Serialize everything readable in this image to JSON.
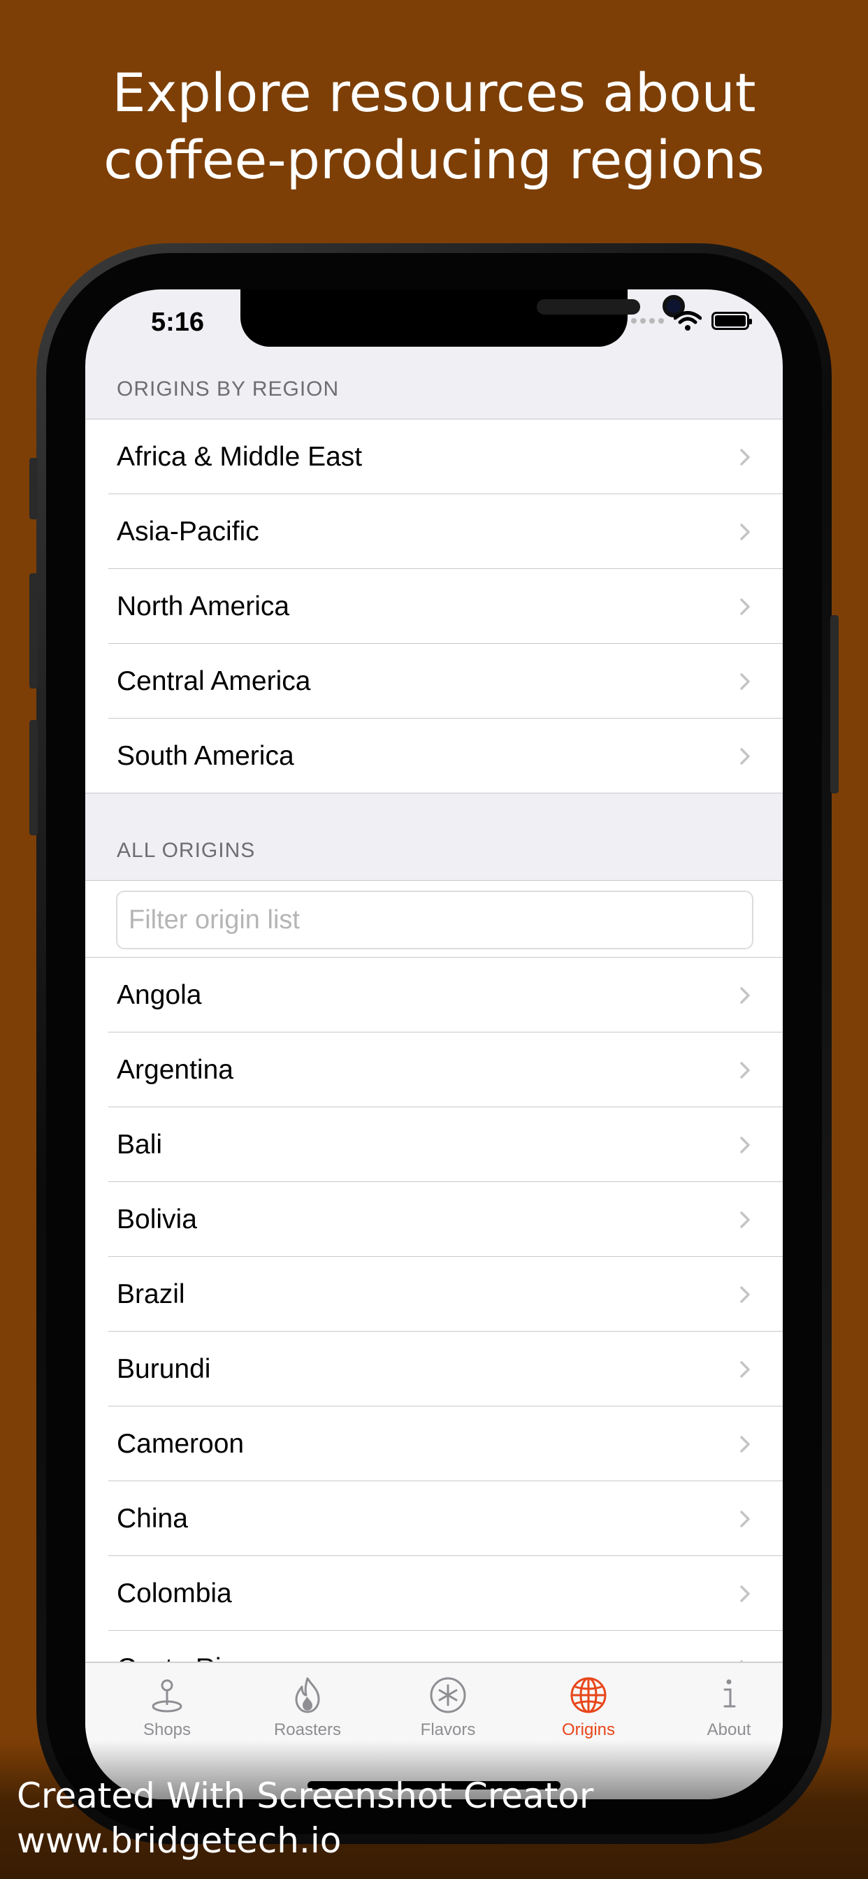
{
  "headline": {
    "line1": "Explore resources about",
    "line2": "coffee-producing regions"
  },
  "status_bar": {
    "time": "5:16"
  },
  "regions": {
    "header": "ORIGINS BY REGION",
    "items": [
      {
        "label": "Africa & Middle East"
      },
      {
        "label": "Asia-Pacific"
      },
      {
        "label": "North America"
      },
      {
        "label": "Central America"
      },
      {
        "label": "South America"
      }
    ]
  },
  "all_origins": {
    "header": "ALL ORIGINS",
    "filter": {
      "placeholder": "Filter origin list",
      "value": ""
    },
    "items": [
      {
        "label": "Angola"
      },
      {
        "label": "Argentina"
      },
      {
        "label": "Bali"
      },
      {
        "label": "Bolivia"
      },
      {
        "label": "Brazil"
      },
      {
        "label": "Burundi"
      },
      {
        "label": "Cameroon"
      },
      {
        "label": "China"
      },
      {
        "label": "Colombia"
      },
      {
        "label": "Costa Rica"
      }
    ]
  },
  "tabbar": {
    "tabs": [
      {
        "label": "Shops",
        "icon": "map-pin-icon",
        "active": false
      },
      {
        "label": "Roasters",
        "icon": "flame-icon",
        "active": false
      },
      {
        "label": "Flavors",
        "icon": "asterisk-icon",
        "active": false
      },
      {
        "label": "Origins",
        "icon": "globe-icon",
        "active": true
      },
      {
        "label": "About",
        "icon": "info-icon",
        "active": false
      }
    ]
  },
  "watermark": {
    "line1": "Created With Screenshot Creator",
    "line2": "www.bridgetech.io"
  },
  "colors": {
    "background": "#7d3f06",
    "accent": "#e8461a",
    "inactive_tab": "#8e8e93"
  }
}
